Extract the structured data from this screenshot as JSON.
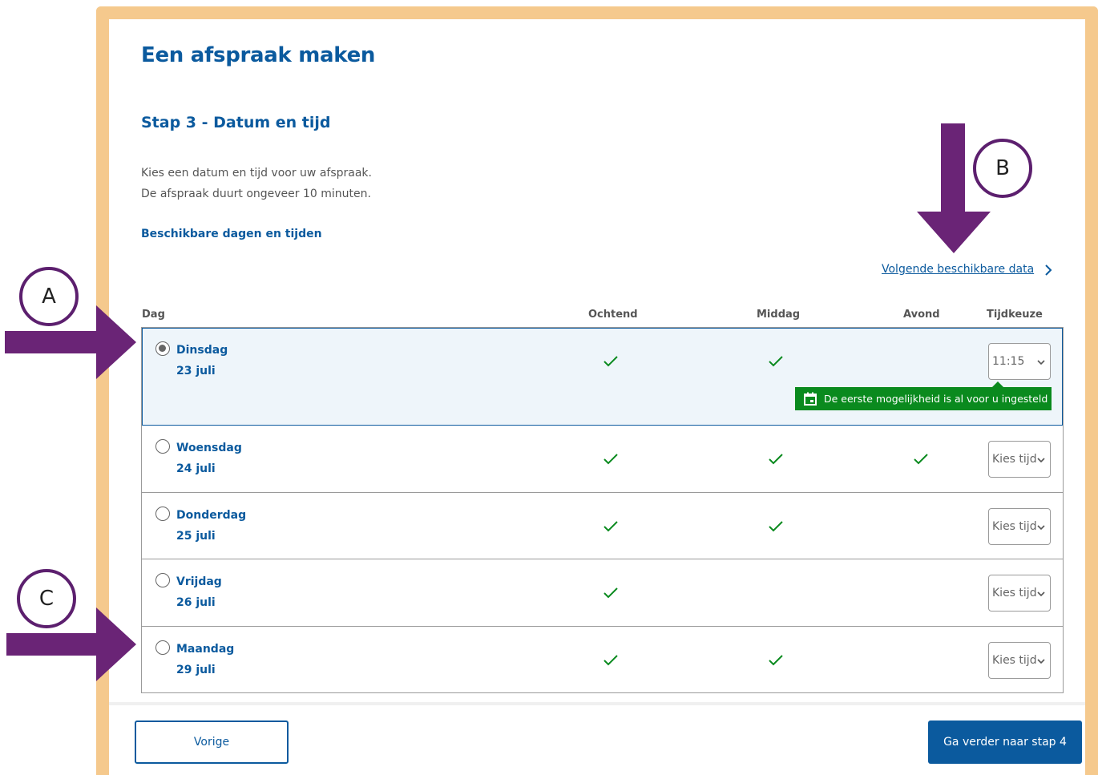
{
  "page": {
    "title": "Een afspraak maken",
    "step_title": "Stap 3 - Datum en tijd",
    "intro_line1": "Kies een datum en tijd voor uw afspraak.",
    "intro_line2": "De afspraak duurt ongeveer 10 minuten.",
    "subheading": "Beschikbare dagen en tijden",
    "next_dates_link": "Volgende beschikbare data"
  },
  "columns": {
    "day": "Dag",
    "morning": "Ochtend",
    "afternoon": "Middag",
    "evening": "Avond",
    "time": "Tijdkeuze"
  },
  "rows": [
    {
      "day": "Dinsdag",
      "date": "23 juli",
      "selected": true,
      "morning": true,
      "afternoon": true,
      "evening": false,
      "time": "11:15"
    },
    {
      "day": "Woensdag",
      "date": "24 juli",
      "selected": false,
      "morning": true,
      "afternoon": true,
      "evening": true,
      "time": "Kies tijd"
    },
    {
      "day": "Donderdag",
      "date": "25 juli",
      "selected": false,
      "morning": true,
      "afternoon": true,
      "evening": false,
      "time": "Kies tijd"
    },
    {
      "day": "Vrijdag",
      "date": "26 juli",
      "selected": false,
      "morning": true,
      "afternoon": false,
      "evening": false,
      "time": "Kies tijd"
    },
    {
      "day": "Maandag",
      "date": "29 juli",
      "selected": false,
      "morning": true,
      "afternoon": true,
      "evening": false,
      "time": "Kies tijd"
    }
  ],
  "tooltip": "De eerste mogelijkheid is al voor u ingesteld",
  "buttons": {
    "previous": "Vorige",
    "next": "Ga verder naar stap 4"
  },
  "annotations": {
    "a": "A",
    "b": "B",
    "c": "C"
  },
  "colors": {
    "brand_blue": "#0b5a9e",
    "frame_orange": "#f5c98d",
    "check_green": "#0a8a1e",
    "arrow_purple": "#6a2476"
  }
}
